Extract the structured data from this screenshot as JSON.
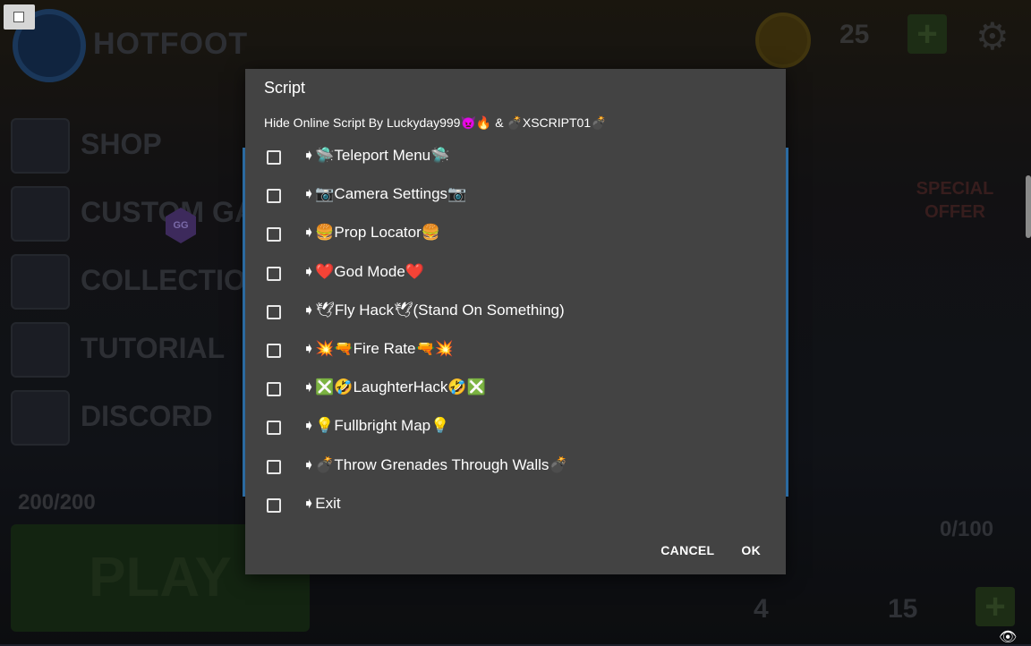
{
  "background": {
    "game_title": "HOTFOOT",
    "menu": [
      "SHOP",
      "CUSTOM GAM",
      "COLLECTION",
      "TUTORIAL",
      "DISCORD"
    ],
    "coins": "25",
    "special_offer": "SPECIAL OFFER",
    "energy": "200/200",
    "play_label": "PLAY",
    "progress": "0/100",
    "count_a": "4",
    "count_b": "15",
    "gg_icon_text": "GG"
  },
  "dialog": {
    "title": "Script",
    "subtitle": "Hide Online Script By Luckyday999👿🔥 & 💣XSCRIPT01💣",
    "items": [
      {
        "label": "➧🛸Teleport Menu🛸",
        "checked": false
      },
      {
        "label": "➧📷Camera Settings📷",
        "checked": false
      },
      {
        "label": "➧🍔Prop Locator🍔",
        "checked": false
      },
      {
        "label": "➧❤️God Mode❤️",
        "checked": false
      },
      {
        "label": "➧🕊Fly Hack🕊(Stand On Something)",
        "checked": false
      },
      {
        "label": "➧💥🔫Fire Rate🔫💥",
        "checked": false
      },
      {
        "label": "➧❎🤣LaughterHack🤣❎",
        "checked": false
      },
      {
        "label": "➧💡Fullbright Map💡",
        "checked": false
      },
      {
        "label": "➧💣Throw Grenades Through Walls💣",
        "checked": false
      },
      {
        "label": "➧Exit",
        "checked": false
      }
    ],
    "cancel_label": "CANCEL",
    "ok_label": "OK"
  },
  "colors": {
    "dialog_bg": "#434343",
    "accent_edge": "#2b6aa0"
  }
}
